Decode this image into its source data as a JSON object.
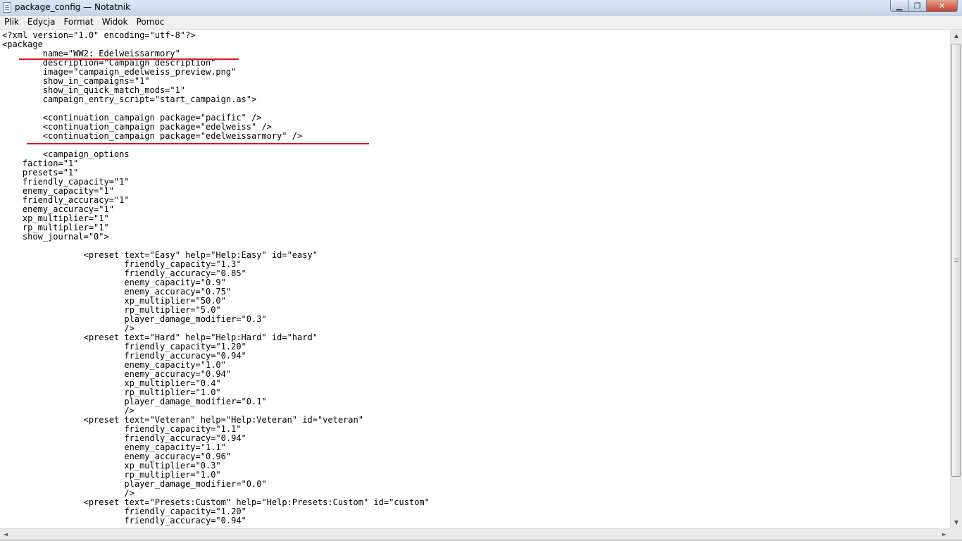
{
  "window": {
    "title": "package_config — Notatnik",
    "controls": {
      "minimize": "▁",
      "maximize": "❐",
      "close": "✕"
    }
  },
  "menu": [
    "Plik",
    "Edycja",
    "Format",
    "Widok",
    "Pomoc"
  ],
  "icons": {
    "app": "notepad-icon",
    "scroll_up": "▲",
    "scroll_down": "▼",
    "scroll_left": "◄",
    "scroll_right": "►"
  },
  "annotation_color": "#e0151f",
  "editor": {
    "text": "<?xml version=\"1.0\" encoding=\"utf-8\"?>\n<package\n\tname=\"WW2: Edelweissarmory\"\n\tdescription=\"Campaign description\"\n\timage=\"campaign_edelweiss_preview.png\"\n\tshow_in_campaigns=\"1\"\n\tshow_in_quick_match_mods=\"1\"\n\tcampaign_entry_script=\"start_campaign.as\">\n\n\t<continuation_campaign package=\"pacific\" />\n\t<continuation_campaign package=\"edelweiss\" />\n\t<continuation_campaign package=\"edelweissarmory\" />\n\n\t<campaign_options\n    faction=\"1\"\n    presets=\"1\"\n    friendly_capacity=\"1\"\n    enemy_capacity=\"1\"\n    friendly_accuracy=\"1\"\n    enemy_accuracy=\"1\"\n    xp_multiplier=\"1\"\n    rp_multiplier=\"1\"\n    show_journal=\"0\">\n\n\t\t<preset text=\"Easy\" help=\"Help:Easy\" id=\"easy\"\n\t\t\tfriendly_capacity=\"1.3\"\n\t\t\tfriendly_accuracy=\"0.85\"\n\t\t\tenemy_capacity=\"0.9\"\n\t\t\tenemy_accuracy=\"0.75\"\n\t\t\txp_multiplier=\"50.0\"\n\t\t\trp_multiplier=\"5.0\"\n\t\t\tplayer_damage_modifier=\"0.3\"\n\t\t\t/>\n\t\t<preset text=\"Hard\" help=\"Help:Hard\" id=\"hard\"\n\t\t\tfriendly_capacity=\"1.20\"\n\t\t\tfriendly_accuracy=\"0.94\"\n\t\t\tenemy_capacity=\"1.0\"\n\t\t\tenemy_accuracy=\"0.94\"\n\t\t\txp_multiplier=\"0.4\"\n\t\t\trp_multiplier=\"1.0\"\n\t\t\tplayer_damage_modifier=\"0.1\"\n\t\t\t/>\n\t\t<preset text=\"Veteran\" help=\"Help:Veteran\" id=\"veteran\"\n\t\t\tfriendly_capacity=\"1.1\"\n\t\t\tfriendly_accuracy=\"0.94\"\n\t\t\tenemy_capacity=\"1.1\"\n\t\t\tenemy_accuracy=\"0.96\"\n\t\t\txp_multiplier=\"0.3\"\n\t\t\trp_multiplier=\"1.0\"\n\t\t\tplayer_damage_modifier=\"0.0\"\n\t\t\t/>\n\t\t<preset text=\"Presets:Custom\" help=\"Help:Presets:Custom\" id=\"custom\"\n\t\t\tfriendly_capacity=\"1.20\"\n\t\t\tfriendly_accuracy=\"0.94\""
  }
}
